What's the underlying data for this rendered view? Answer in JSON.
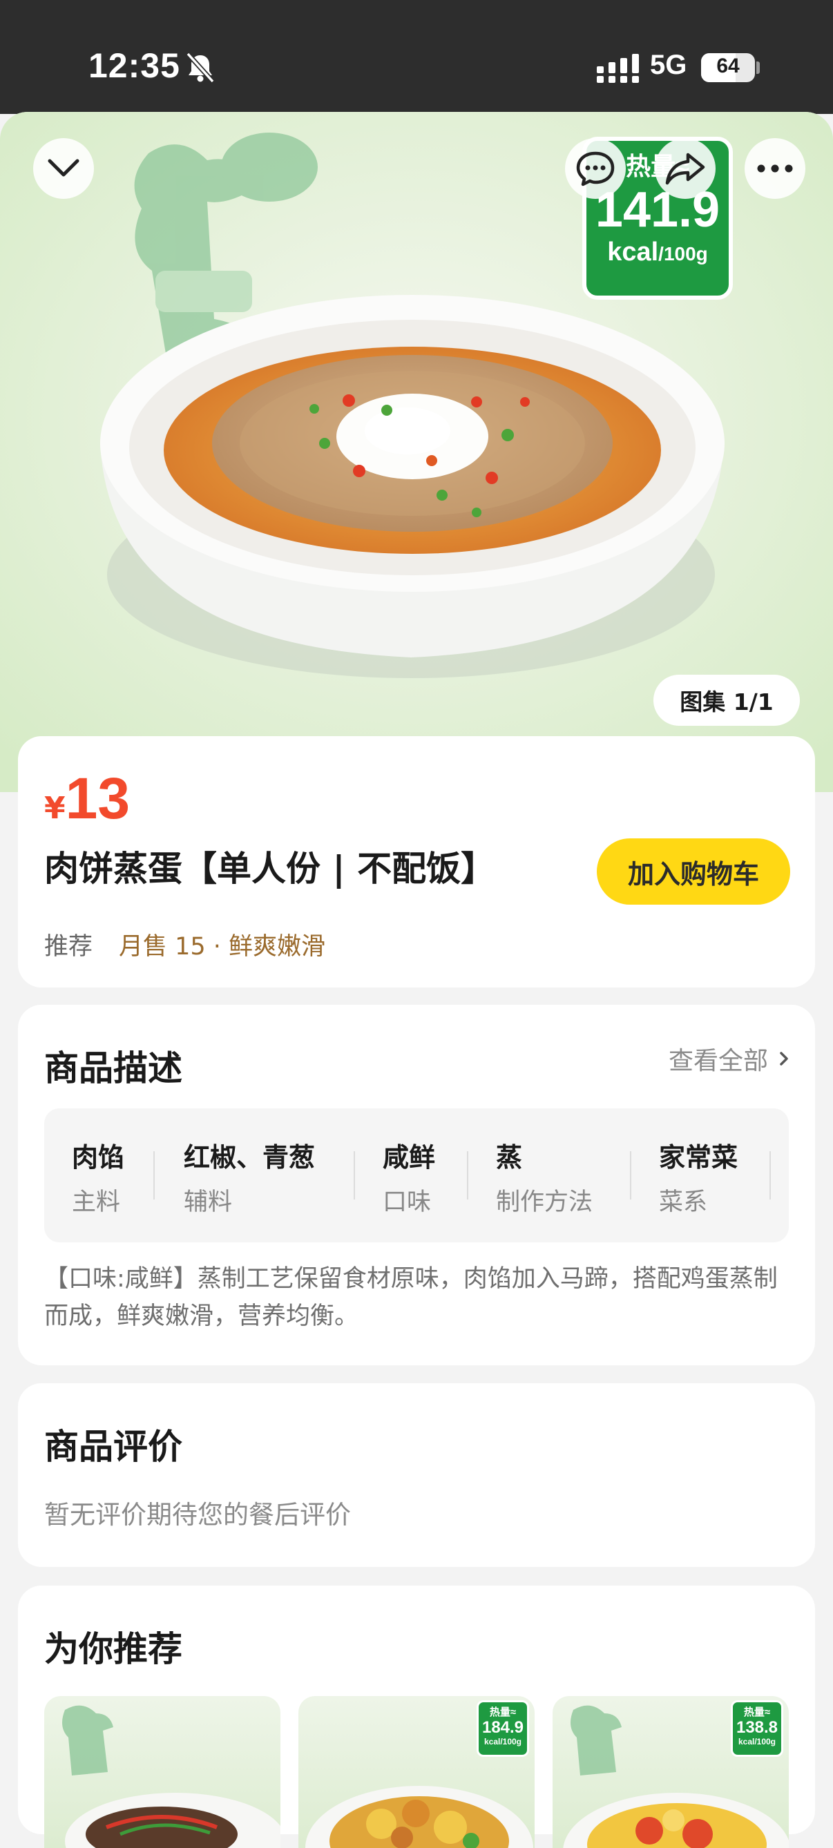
{
  "status_bar": {
    "time": "12:35",
    "network": "5G",
    "battery": "64",
    "battery_level": 0.64
  },
  "hero": {
    "calorie_badge": {
      "label": "热量≈",
      "value": "141.9",
      "unit": "kcal",
      "per": "/100g"
    },
    "gallery": "图集 1/1",
    "icons": [
      "chevron-down-icon",
      "message-icon",
      "share-icon",
      "more-icon"
    ]
  },
  "product": {
    "currency": "¥",
    "price": "13",
    "name": "肉饼蒸蛋【单人份 | 不配饭】",
    "add_to_cart": "加入购物车",
    "tag": "推荐",
    "sales": "月售 15 · 鲜爽嫩滑"
  },
  "description": {
    "title": "商品描述",
    "view_all": "查看全部",
    "attributes": [
      {
        "value": "肉馅",
        "label": "主料"
      },
      {
        "value": "红椒、青葱",
        "label": "辅料"
      },
      {
        "value": "咸鲜",
        "label": "口味"
      },
      {
        "value": "蒸",
        "label": "制作方法"
      },
      {
        "value": "家常菜",
        "label": "菜系"
      }
    ],
    "text": "【口味:咸鲜】蒸制工艺保留食材原味，肉馅加入马蹄，搭配鸡蛋蒸制而成，鲜爽嫩滑，营养均衡。"
  },
  "reviews": {
    "title": "商品评价",
    "empty": "暂无评价期待您的餐后评价"
  },
  "recommendations": {
    "title": "为你推荐",
    "items": [
      {
        "badge_label": "",
        "badge_value": "",
        "badge_unit": ""
      },
      {
        "badge_label": "热量≈",
        "badge_value": "184.9",
        "badge_unit": "kcal/100g"
      },
      {
        "badge_label": "热量≈",
        "badge_value": "138.8",
        "badge_unit": "kcal/100g"
      }
    ]
  },
  "colors": {
    "price": "#f24a2c",
    "cart_button": "#ffd814",
    "calorie_badge": "#1e9a41",
    "sales_text": "#9a6a2c"
  }
}
